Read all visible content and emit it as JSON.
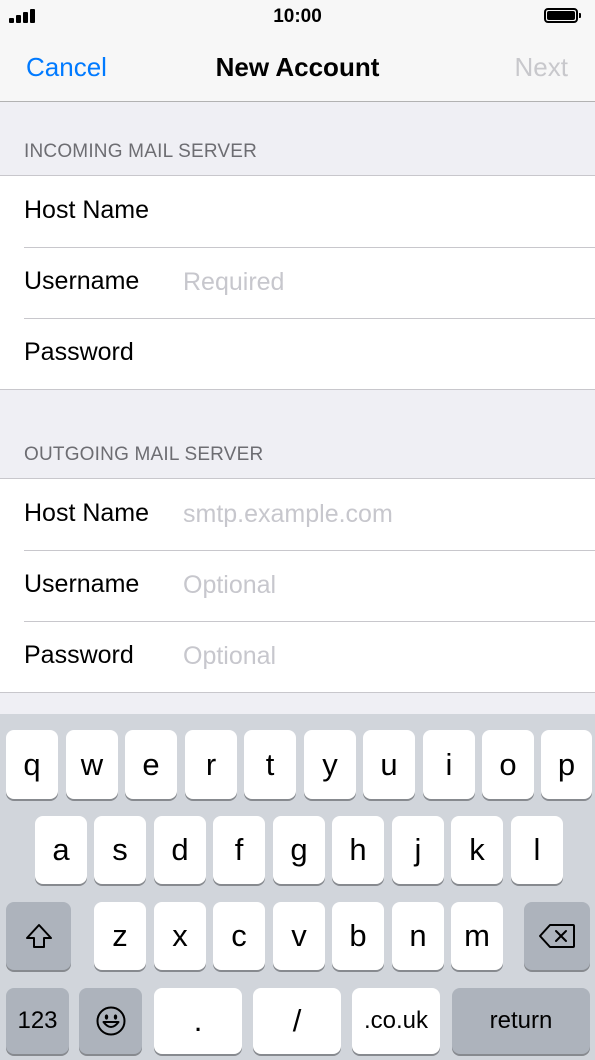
{
  "status_bar": {
    "time": "10:00",
    "signal_icon": "signal-icon",
    "battery_icon": "battery-icon"
  },
  "nav": {
    "cancel": "Cancel",
    "title": "New Account",
    "next": "Next",
    "accent_color": "#007aff",
    "disabled_color": "#c8c8cc"
  },
  "incoming": {
    "header": "INCOMING MAIL SERVER",
    "host_label": "Host Name",
    "host_placeholder": "",
    "username_label": "Username",
    "username_placeholder": "Required",
    "password_label": "Password",
    "password_placeholder": ""
  },
  "outgoing": {
    "header": "OUTGOING MAIL SERVER",
    "host_label": "Host Name",
    "host_placeholder": "smtp.example.com",
    "username_label": "Username",
    "username_placeholder": "Optional",
    "password_label": "Password",
    "password_placeholder": "Optional"
  },
  "keyboard": {
    "row1": [
      "q",
      "w",
      "e",
      "r",
      "t",
      "y",
      "u",
      "i",
      "o",
      "p"
    ],
    "row2": [
      "a",
      "s",
      "d",
      "f",
      "g",
      "h",
      "j",
      "k",
      "l"
    ],
    "row3": [
      "z",
      "x",
      "c",
      "v",
      "b",
      "n",
      "m"
    ],
    "shift_icon": "shift-icon",
    "delete_icon": "delete-icon",
    "emoji_icon": "emoji-icon",
    "numbers": "123",
    "period": ".",
    "slash": "/",
    "domain": ".co.uk",
    "return": "return"
  }
}
